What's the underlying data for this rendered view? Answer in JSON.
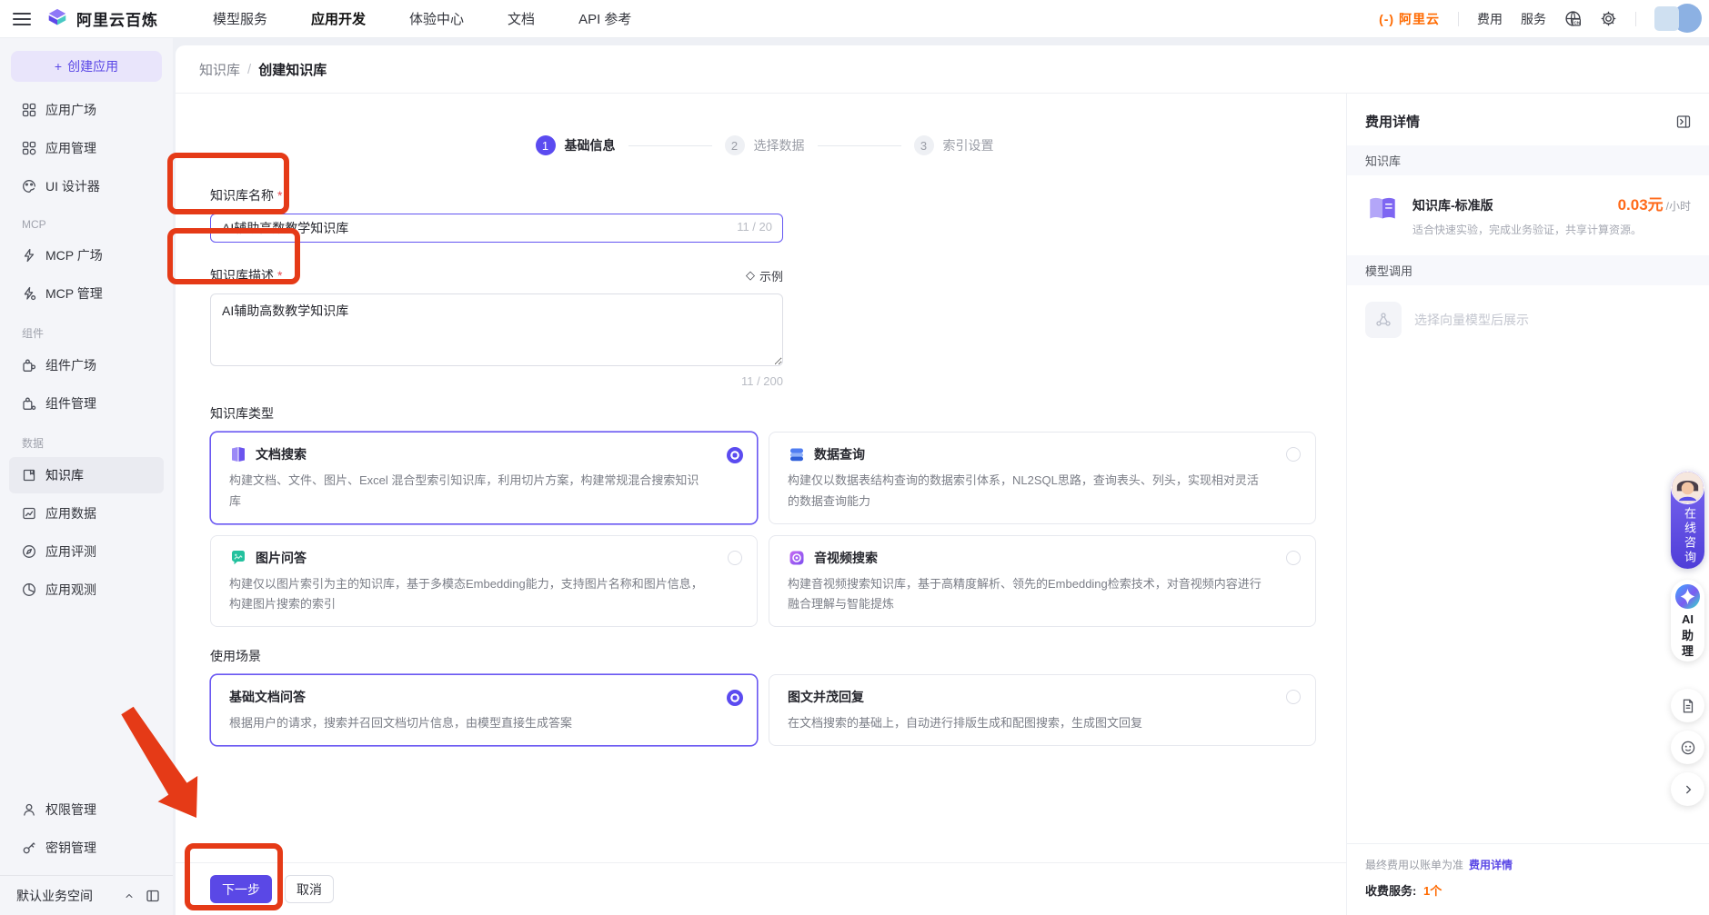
{
  "topbar": {
    "brand": "阿里云百炼",
    "nav": [
      {
        "label": "模型服务"
      },
      {
        "label": "应用开发"
      },
      {
        "label": "体验中心"
      },
      {
        "label": "文档"
      },
      {
        "label": "API 参考"
      }
    ],
    "aliyun_logo": "(-) 阿里云",
    "right_items": [
      {
        "label": "费用"
      },
      {
        "label": "服务"
      }
    ]
  },
  "sidebar": {
    "create_plus": "+",
    "create_label": "创建应用",
    "top_items": [
      {
        "label": "应用广场"
      },
      {
        "label": "应用管理"
      },
      {
        "label": "UI 设计器"
      }
    ],
    "sections": [
      {
        "header": "MCP",
        "items": [
          {
            "label": "MCP 广场"
          },
          {
            "label": "MCP 管理"
          }
        ]
      },
      {
        "header": "组件",
        "items": [
          {
            "label": "组件广场"
          },
          {
            "label": "组件管理"
          }
        ]
      },
      {
        "header": "数据",
        "items": [
          {
            "label": "知识库"
          },
          {
            "label": "应用数据"
          },
          {
            "label": "应用评测"
          },
          {
            "label": "应用观测"
          }
        ]
      }
    ],
    "bottom_items": [
      {
        "label": "权限管理"
      },
      {
        "label": "密钥管理"
      }
    ],
    "workspace": "默认业务空间"
  },
  "breadcrumb": {
    "parent": "知识库",
    "sep": "/",
    "current": "创建知识库"
  },
  "steps": [
    {
      "num": "1",
      "label": "基础信息"
    },
    {
      "num": "2",
      "label": "选择数据"
    },
    {
      "num": "3",
      "label": "索引设置"
    }
  ],
  "form": {
    "required_mark": "*",
    "name": {
      "label": "知识库名称",
      "value": "AI辅助高数教学知识库",
      "counter": "11 / 20"
    },
    "desc": {
      "label": "知识库描述",
      "example_icon": "◇",
      "example": "示例",
      "value": "AI辅助高数教学知识库",
      "counter": "11 / 200"
    },
    "type_label": "知识库类型",
    "type_options": [
      {
        "title": "文档搜索",
        "desc": "构建文档、文件、图片、Excel 混合型索引知识库，利用切片方案，构建常规混合搜索知识库"
      },
      {
        "title": "数据查询",
        "desc": "构建仅以数据表结构查询的数据索引体系，NL2SQL思路，查询表头、列头，实现相对灵活的数据查询能力"
      },
      {
        "title": "图片问答",
        "desc": "构建仅以图片索引为主的知识库，基于多模态Embedding能力，支持图片名称和图片信息，构建图片搜索的索引"
      },
      {
        "title": "音视频搜索",
        "desc": "构建音视频搜索知识库，基于高精度解析、领先的Embedding检索技术，对音视频内容进行融合理解与智能提炼"
      }
    ],
    "scene_label": "使用场景",
    "scene_options": [
      {
        "title": "基础文档问答",
        "desc": "根据用户的请求，搜索并召回文档切片信息，由模型直接生成答案"
      },
      {
        "title": "图文并茂回复",
        "desc": "在文档搜索的基础上，自动进行排版生成和配图搜索，生成图文回复"
      }
    ],
    "next": "下一步",
    "cancel": "取消"
  },
  "cost_panel": {
    "title": "费用详情",
    "kb_header": "知识库",
    "kb_name": "知识库-标准版",
    "kb_price": "0.03元",
    "kb_unit": "/小时",
    "kb_desc": "适合快速实验，完成业务验证，共享计算资源。",
    "model_header": "模型调用",
    "model_placeholder": "选择向量模型后展示",
    "footer_note": "最终费用以账单为准",
    "footer_link": "费用详情",
    "fee_label": "收费服务:",
    "fee_value": "1个"
  },
  "floats": {
    "consult": "在线咨询",
    "ai_l1": "AI",
    "ai_l2": "助",
    "ai_l3": "理"
  }
}
